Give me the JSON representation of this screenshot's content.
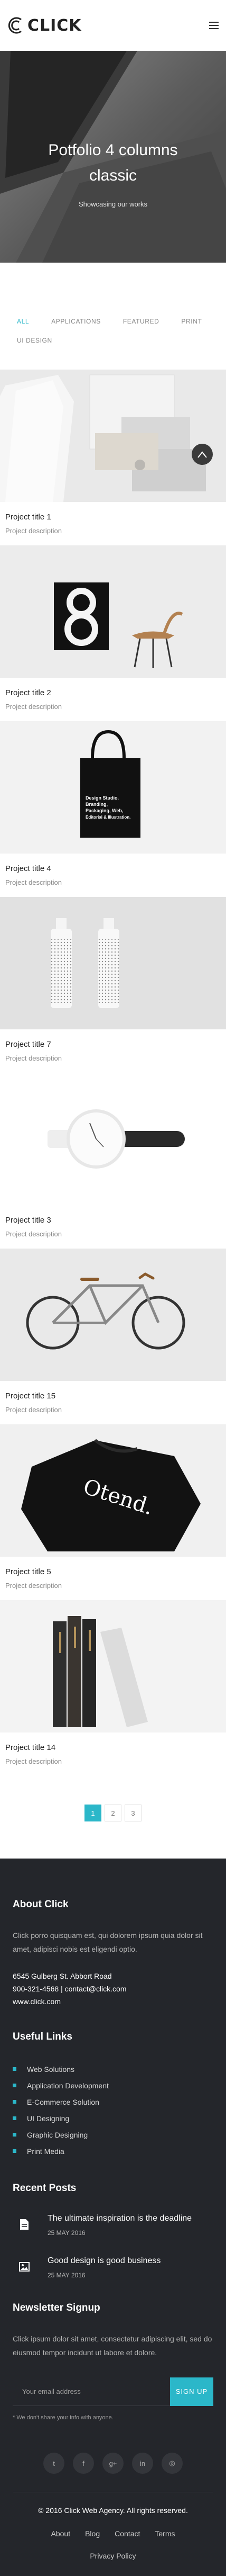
{
  "header": {
    "logo_text": "CLICK",
    "menu_icon": "hamburger-icon"
  },
  "hero": {
    "title": "Potfolio 4 columns classic",
    "subtitle": "Showcasing our works"
  },
  "filters": [
    {
      "label": "All",
      "active": true
    },
    {
      "label": "Applications",
      "active": false
    },
    {
      "label": "Featured",
      "active": false
    },
    {
      "label": "Print",
      "active": false
    },
    {
      "label": "UI Design",
      "active": false
    }
  ],
  "items": [
    {
      "title": "Project title 1",
      "desc": "Project description",
      "has_plus": true
    },
    {
      "title": "Project title 2",
      "desc": "Project description"
    },
    {
      "title": "Project title 4",
      "desc": "Project description"
    },
    {
      "title": "Project title 7",
      "desc": "Project description"
    },
    {
      "title": "Project title 3",
      "desc": "Project description"
    },
    {
      "title": "Project title 15",
      "desc": "Project description"
    },
    {
      "title": "Project title 5",
      "desc": "Project description"
    },
    {
      "title": "Project title 14",
      "desc": "Project description"
    }
  ],
  "tote_text": [
    "Design Studio.",
    "Branding,",
    "Packaging, Web,",
    "Editorial & Illustration."
  ],
  "shirt_text": "Otend.",
  "pagination": {
    "pages": [
      "1",
      "2",
      "3"
    ],
    "active": 0
  },
  "footer": {
    "about": {
      "heading": "About Click",
      "text": "Click porro quisquam est, qui dolorem ipsum quia dolor sit amet, adipisci nobis est eligendi optio.",
      "address": "6545 Gulberg St. Abbort Road",
      "contact": "900-321-4568 | contact@click.com",
      "site": "www.click.com"
    },
    "links": {
      "heading": "Useful Links",
      "items": [
        "Web Solutions",
        "Application Development",
        "E-Commerce Solution",
        "UI Designing",
        "Graphic Designing",
        "Print Media"
      ]
    },
    "posts": {
      "heading": "Recent Posts",
      "items": [
        {
          "title": "The ultimate inspiration is the deadline",
          "date": "25 MAY 2016",
          "icon": "document-icon"
        },
        {
          "title": "Good design is good business",
          "date": "25 MAY 2016",
          "icon": "image-icon"
        }
      ]
    },
    "newsletter": {
      "heading": "Newsletter Signup",
      "text": "Click ipsum dolor sit amet, consectetur adipiscing elit, sed do eiusmod tempor incidunt ut labore et dolore.",
      "placeholder": "Your email address",
      "button": "SIGN UP",
      "note": "* We don't share your info with anyone."
    },
    "socials": [
      {
        "icon": "twitter-icon",
        "glyph": "t"
      },
      {
        "icon": "facebook-icon",
        "glyph": "f"
      },
      {
        "icon": "google-plus-icon",
        "glyph": "g+"
      },
      {
        "icon": "linkedin-icon",
        "glyph": "in"
      },
      {
        "icon": "dribbble-icon",
        "glyph": "◎"
      }
    ],
    "copyright": "© 2016 Click Web Agency. All rights reserved.",
    "nav": [
      "About",
      "Blog",
      "Contact",
      "Terms"
    ],
    "nav2": "Privacy Policy"
  },
  "colors": {
    "accent": "#2bb7c9",
    "footer_bg": "#24262b"
  }
}
